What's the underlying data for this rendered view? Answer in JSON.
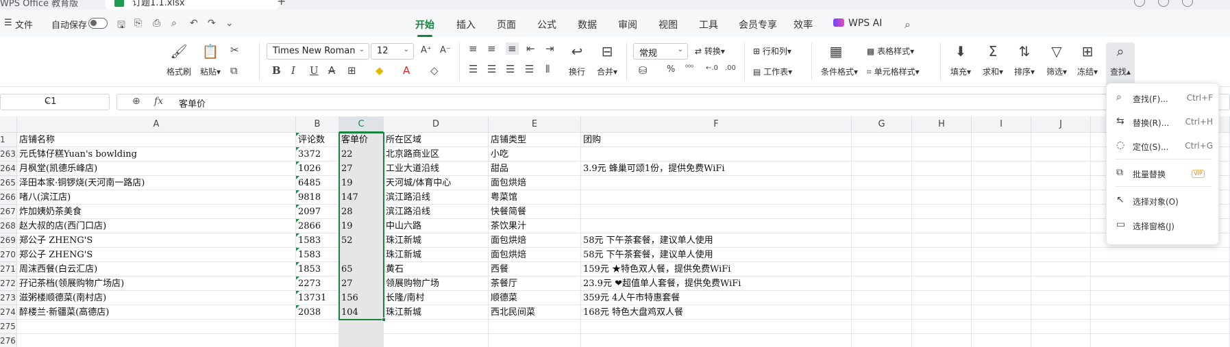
{
  "tabstrip": {
    "app_name": "WPS Office 教育版",
    "doc_title": "订题1.1.xlsx",
    "new_tab": "+"
  },
  "menubar": {
    "menu_icon": "☰",
    "file": "文件",
    "autosave": "自动保存",
    "tabs": [
      "开始",
      "插入",
      "页面",
      "公式",
      "数据",
      "审阅",
      "视图",
      "工具",
      "会员专享",
      "效率"
    ],
    "active_tab": "开始",
    "wps_ai": "WPS AI"
  },
  "ribbon": {
    "format_painter": "格式刷",
    "paste": "粘贴",
    "font_name": "Times New Roman",
    "font_size": "12",
    "wrap": "换行",
    "merge": "合并",
    "number_format": "常规",
    "convert": "转换",
    "rows_cols": "行和列",
    "worksheet": "工作表",
    "cond_format": "条件格式",
    "table_style": "表格样式",
    "cell_style": "单元格样式",
    "fill": "填充",
    "sum": "求和",
    "sort": "排序",
    "filter": "筛选",
    "freeze": "冻结",
    "find": "查找",
    "percent": "%"
  },
  "formulabar": {
    "cell_ref": "C1",
    "fx": "fx",
    "content": "客单价"
  },
  "grid": {
    "columns": [
      "A",
      "B",
      "C",
      "D",
      "E",
      "F",
      "G",
      "H",
      "I",
      "J"
    ],
    "header_row": {
      "num": "1",
      "cells": [
        "店铺名称",
        "评论数",
        "客单价",
        "所在区域",
        "店铺类型",
        "团购"
      ]
    },
    "rows": [
      {
        "num": "263",
        "cells": [
          "元氏钵仔糕Yuan's bowlding",
          "3372",
          "22",
          "北京路商业区",
          "小吃",
          ""
        ]
      },
      {
        "num": "264",
        "cells": [
          "月枫堂(凯德乐峰店)",
          "1026",
          "27",
          "工业大道沿线",
          "甜品",
          "3.9元 蜂巢可颂1份，提供免费WiFi"
        ]
      },
      {
        "num": "265",
        "cells": [
          "泽田本家·铜锣烧(天河南一路店)",
          "6485",
          "19",
          "天河城/体育中心",
          "面包烘焙",
          ""
        ]
      },
      {
        "num": "266",
        "cells": [
          "啫八(滨江店)",
          "9818",
          "147",
          "滨江路沿线",
          "粤菜馆",
          ""
        ]
      },
      {
        "num": "267",
        "cells": [
          "炸加姨奶茶美食",
          "2097",
          "28",
          "滨江路沿线",
          "快餐简餐",
          ""
        ]
      },
      {
        "num": "268",
        "cells": [
          "赵大叔的店(西门口店)",
          "2866",
          "19",
          "中山六路",
          "茶饮果汁",
          ""
        ]
      },
      {
        "num": "269",
        "cells": [
          "郑公子 ZHENG'S",
          "1583",
          "52",
          "珠江新城",
          "面包烘焙",
          "58元 下午茶套餐，建议单人使用"
        ]
      },
      {
        "num": "270",
        "cells": [
          "郑公子 ZHENG'S",
          "1583",
          "",
          "珠江新城",
          "面包烘焙",
          "58元 下午茶套餐，建议单人使用"
        ]
      },
      {
        "num": "271",
        "cells": [
          "周沫西餐(白云汇店)",
          "1853",
          "65",
          "黄石",
          "西餐",
          "159元 ★特色双人餐，提供免费WiFi"
        ]
      },
      {
        "num": "272",
        "cells": [
          "孖记茶档(领展购物广场店)",
          "2273",
          "27",
          "领展购物广场",
          "茶餐厅",
          "23.9元 ❤超值单人套餐，提供免费WiFi"
        ]
      },
      {
        "num": "273",
        "cells": [
          "滋粥楼顺德菜(南村店)",
          "13731",
          "156",
          "长隆/南村",
          "顺德菜",
          "359元 4人午市特惠套餐"
        ]
      },
      {
        "num": "274",
        "cells": [
          "醉楼兰·新疆菜(高德店)",
          "2038",
          "104",
          "珠江新城",
          "西北民间菜",
          "168元 特色大盘鸡双人餐"
        ]
      },
      {
        "num": "275",
        "cells": [
          "",
          "",
          "",
          "",
          "",
          ""
        ]
      },
      {
        "num": "276",
        "cells": [
          "",
          "",
          "",
          "",
          "",
          ""
        ]
      }
    ]
  },
  "findmenu": {
    "items": [
      {
        "label": "查找(F)...",
        "key": "Ctrl+F",
        "icon": "search-icon"
      },
      {
        "label": "替换(R)...",
        "key": "Ctrl+H",
        "icon": "replace-icon"
      },
      {
        "label": "定位(S)...",
        "key": "Ctrl+G",
        "icon": "locate-icon"
      },
      {
        "label": "批量替换",
        "key": "",
        "icon": "batch-replace-icon",
        "badge": "VIP"
      },
      {
        "label": "选择对象(O)",
        "key": "",
        "icon": "select-object-icon"
      },
      {
        "label": "选择窗格(J)",
        "key": "",
        "icon": "selection-pane-icon"
      }
    ]
  },
  "colors": {
    "accent": "#17833f",
    "selected_column_fill": "#e6e6e6"
  }
}
